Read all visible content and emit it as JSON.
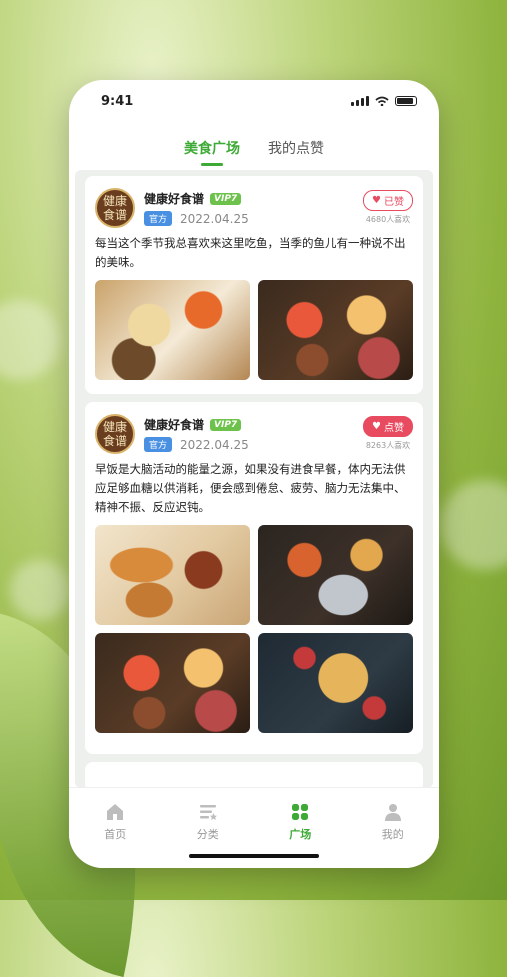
{
  "status": {
    "time": "9:41"
  },
  "tabs": [
    {
      "label": "美食广场",
      "active": true
    },
    {
      "label": "我的点赞",
      "active": false
    }
  ],
  "posts": [
    {
      "avatar_text": "健康食谱",
      "username": "健康好食谱",
      "vip": "VIP7",
      "official": "官方",
      "date": "2022.04.25",
      "like_label": "已赞",
      "liked": true,
      "like_count": "4680人喜欢",
      "text": "每当这个季节我总喜欢来这里吃鱼，当季的鱼儿有一种说不出的美味。",
      "images": [
        "fish-dish-image",
        "feast-table-image"
      ]
    },
    {
      "avatar_text": "健康食谱",
      "username": "健康好食谱",
      "vip": "VIP7",
      "official": "官方",
      "date": "2022.04.25",
      "like_label": "点赞",
      "liked": false,
      "like_count": "8263人喜欢",
      "text": "早饭是大脑活动的能量之源，如果没有进食早餐，体内无法供应足够血糖以供消耗，便会感到倦怠、疲劳、脑力无法集中、精神不振、反应迟钝。",
      "images": [
        "pastry-image",
        "breakfast-spread-image",
        "feast-table-image",
        "pancake-berries-image"
      ]
    }
  ],
  "nav": [
    {
      "label": "首页",
      "icon": "home-icon",
      "active": false
    },
    {
      "label": "分类",
      "icon": "category-icon",
      "active": false
    },
    {
      "label": "广场",
      "icon": "plaza-icon",
      "active": true
    },
    {
      "label": "我的",
      "icon": "profile-icon",
      "active": false
    }
  ],
  "colors": {
    "accent": "#3eaa36",
    "like": "#e84a5f",
    "vip": "#6cc24a",
    "official": "#4a90e2"
  }
}
